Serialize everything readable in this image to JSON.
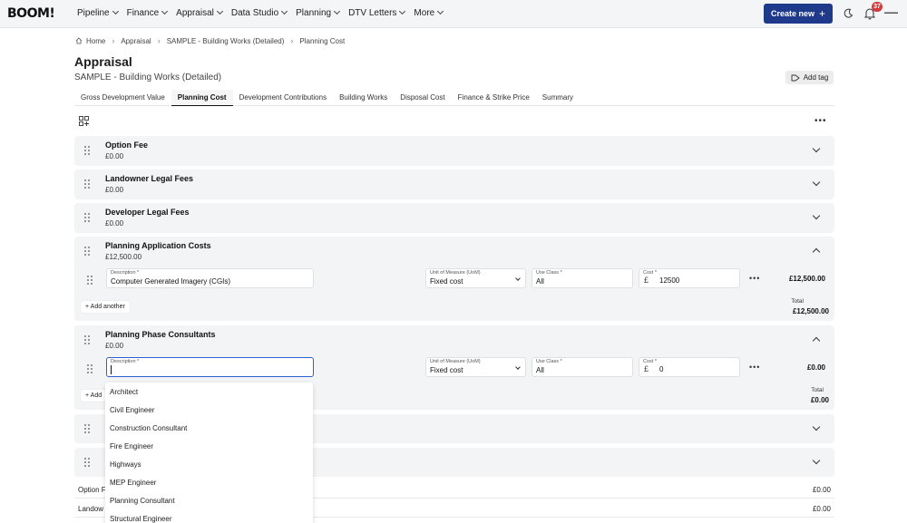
{
  "topbar": {
    "logo": "BOOM!",
    "nav": [
      "Pipeline",
      "Finance",
      "Appraisal",
      "Data Studio",
      "Planning",
      "DTV Letters",
      "More"
    ],
    "create_label": "Create new",
    "notification_count": "37",
    "accent": "#1f3a8a"
  },
  "breadcrumb": [
    "Home",
    "Appraisal",
    "SAMPLE - Building Works (Detailed)",
    "Planning Cost"
  ],
  "page": {
    "title": "Appraisal",
    "subtitle": "SAMPLE - Building Works (Detailed)",
    "add_tag": "Add tag"
  },
  "tabs": [
    "Gross Development Value",
    "Planning Cost",
    "Development Contributions",
    "Building Works",
    "Disposal Cost",
    "Finance & Strike Price",
    "Summary"
  ],
  "sections": [
    {
      "title": "Option Fee",
      "value": "£0.00"
    },
    {
      "title": "Landowner Legal Fees",
      "value": "£0.00"
    },
    {
      "title": "Developer Legal Fees",
      "value": "£0.00"
    },
    {
      "title": "Planning Application Costs",
      "value": "£12,500.00"
    },
    {
      "title": "Planning Phase Consultants",
      "value": "£0.00"
    }
  ],
  "labels": {
    "description": "Description",
    "uom": "Unit of Measure (UoM)",
    "use_class": "Use Class",
    "cost": "Cost",
    "required": "*",
    "currency": "£",
    "add_another": "Add another",
    "total": "Total"
  },
  "planning_app_row": {
    "description": "Computer Generated Imagery (CGIs)",
    "uom": "Fixed cost",
    "use_class": "All",
    "cost": "12500",
    "row_total": "£12,500.00",
    "section_total": "£12,500.00"
  },
  "consultants_row": {
    "description": "",
    "uom": "Fixed cost",
    "use_class": "All",
    "cost": "0",
    "row_total": "£0.00",
    "section_total": "£0.00",
    "add_another_partial": "Add"
  },
  "dropdown_options": [
    "Architect",
    "Civil Engineer",
    "Construction Consultant",
    "Fire Engineer",
    "Highways",
    "MEP Engineer",
    "Planning Consultant",
    "Structural Engineer"
  ],
  "summary": [
    {
      "label": "Option F",
      "value": "£0.00"
    },
    {
      "label": "Landow",
      "value": "£0.00"
    }
  ]
}
